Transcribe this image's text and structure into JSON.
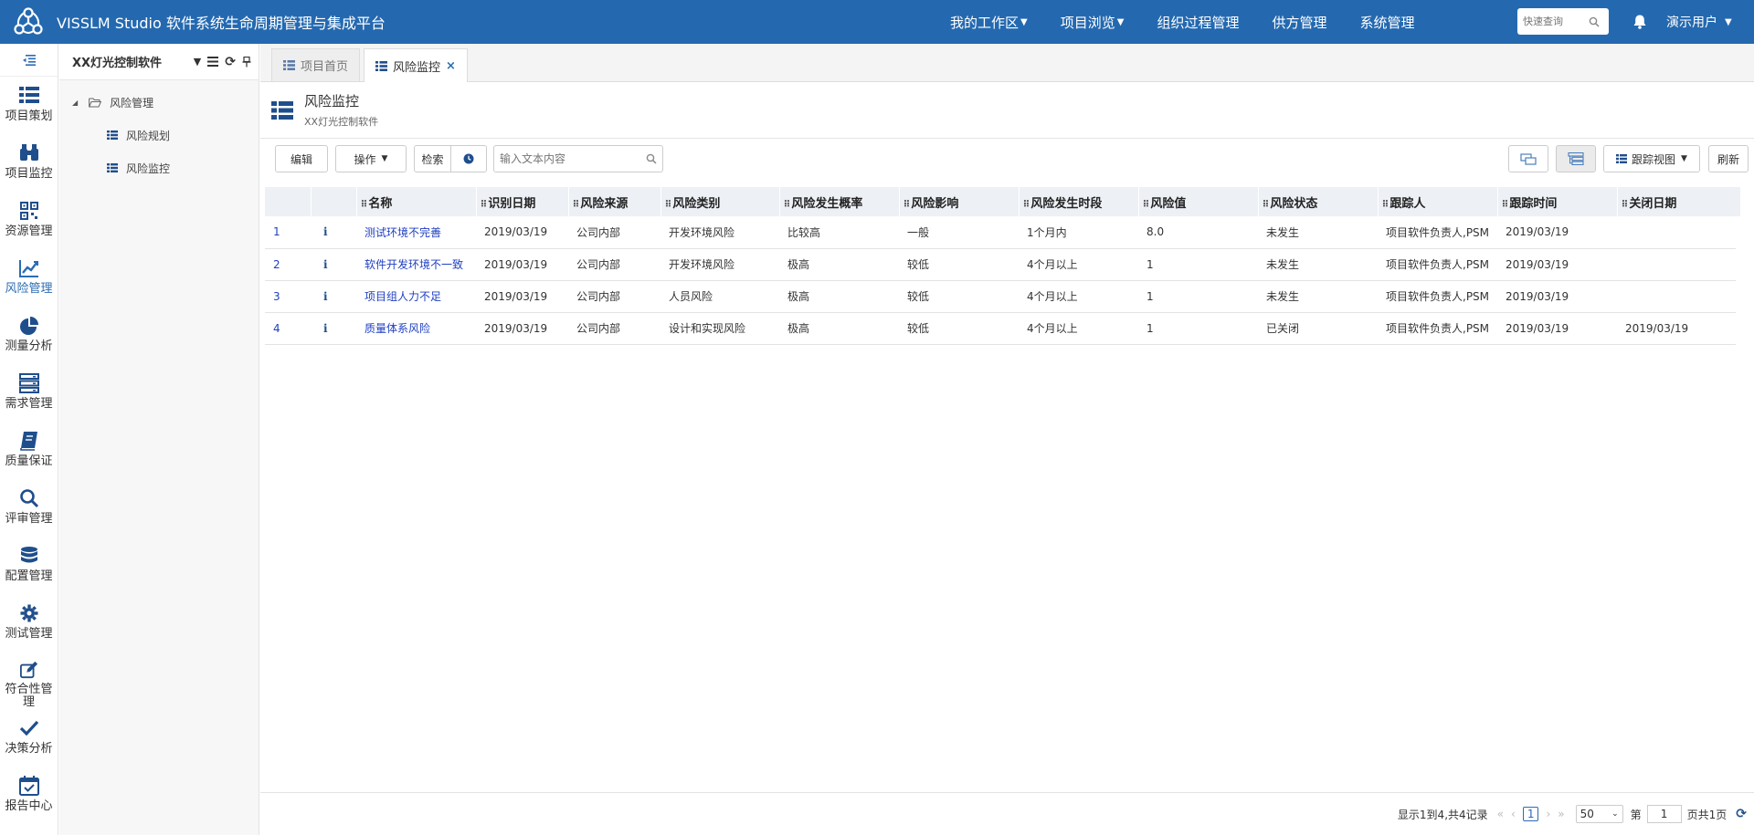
{
  "header": {
    "app_title": "VISSLM Studio 软件系统生命周期管理与集成平台",
    "nav": [
      {
        "label": "我的工作区",
        "dropdown": true
      },
      {
        "label": "项目浏览",
        "dropdown": true
      },
      {
        "label": "组织过程管理",
        "dropdown": false
      },
      {
        "label": "供方管理",
        "dropdown": false
      },
      {
        "label": "系统管理",
        "dropdown": false
      }
    ],
    "quick_search_placeholder": "快速查询",
    "user_label": "演示用户",
    "caret": "▼"
  },
  "sidebar": {
    "items": [
      {
        "label": "项目策划",
        "icon": "list-icon"
      },
      {
        "label": "项目监控",
        "icon": "binoculars-icon"
      },
      {
        "label": "资源管理",
        "icon": "qrcode-icon"
      },
      {
        "label": "风险管理",
        "icon": "line-chart-icon",
        "active": true
      },
      {
        "label": "测量分析",
        "icon": "pie-chart-icon"
      },
      {
        "label": "需求管理",
        "icon": "server-icon"
      },
      {
        "label": "质量保证",
        "icon": "book-icon"
      },
      {
        "label": "评审管理",
        "icon": "search-icon"
      },
      {
        "label": "配置管理",
        "icon": "database-icon"
      },
      {
        "label": "测试管理",
        "icon": "gear-icon"
      },
      {
        "label": "符合性管理",
        "icon": "edit-icon"
      },
      {
        "label": "决策分析",
        "icon": "check-icon"
      },
      {
        "label": "报告中心",
        "icon": "calendar-check-icon"
      }
    ]
  },
  "tree": {
    "project_name": "XX灯光控制软件",
    "root": "风险管理",
    "children": [
      "风险规划",
      "风险监控"
    ]
  },
  "tabs": [
    {
      "label": "项目首页",
      "active": false
    },
    {
      "label": "风险监控",
      "active": true,
      "closable": true
    }
  ],
  "page": {
    "title": "风险监控",
    "subtitle": "XX灯光控制软件"
  },
  "toolbar": {
    "edit_label": "编辑",
    "action_label": "操作",
    "search_label": "检索",
    "search_placeholder": "输入文本内容",
    "view_label": "跟踪视图",
    "refresh_label": "刷新"
  },
  "table": {
    "columns": [
      "名称",
      "识别日期",
      "风险来源",
      "风险类别",
      "风险发生概率",
      "风险影响",
      "风险发生时段",
      "风险值",
      "风险状态",
      "跟踪人",
      "跟踪时间",
      "关闭日期"
    ],
    "rows": [
      {
        "no": "1",
        "info": "i",
        "cells": [
          "测试环境不完善",
          "2019/03/19",
          "公司内部",
          "开发环境风险",
          "比较高",
          "一般",
          "1个月内",
          "8.0",
          "未发生",
          "项目软件负责人,PSM",
          "2019/03/19",
          ""
        ]
      },
      {
        "no": "2",
        "info": "i",
        "cells": [
          "软件开发环境不一致",
          "2019/03/19",
          "公司内部",
          "开发环境风险",
          "极高",
          "较低",
          "4个月以上",
          "1",
          "未发生",
          "项目软件负责人,PSM",
          "2019/03/19",
          ""
        ]
      },
      {
        "no": "3",
        "info": "i",
        "cells": [
          "项目组人力不足",
          "2019/03/19",
          "公司内部",
          "人员风险",
          "极高",
          "较低",
          "4个月以上",
          "1",
          "未发生",
          "项目软件负责人,PSM",
          "2019/03/19",
          ""
        ]
      },
      {
        "no": "4",
        "info": "i",
        "cells": [
          "质量体系风险",
          "2019/03/19",
          "公司内部",
          "设计和实现风险",
          "极高",
          "较低",
          "4个月以上",
          "1",
          "已关闭",
          "项目软件负责人,PSM",
          "2019/03/19",
          "2019/03/19"
        ]
      }
    ]
  },
  "pager": {
    "summary": "显示1到4,共4记录",
    "current_page": "1",
    "page_size": "50",
    "page_prefix": "第",
    "page_input": "1",
    "page_suffix": "页共1页"
  },
  "colors": {
    "header_bg": "#2469b0",
    "accent": "#2a6cb3",
    "link": "#1f3fc2"
  }
}
